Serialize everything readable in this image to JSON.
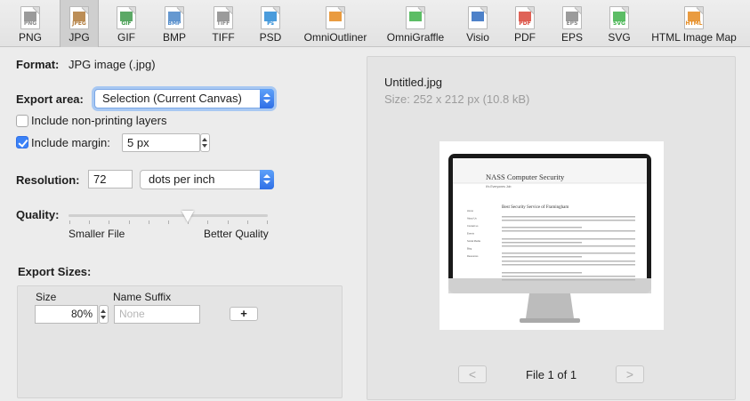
{
  "toolbar": {
    "formats": [
      {
        "label": "PNG",
        "icon": "png-file-icon",
        "ftext": "PNG",
        "color": "#8a8a8a",
        "selected": false
      },
      {
        "label": "JPG",
        "icon": "jpg-file-icon",
        "ftext": "JPEG",
        "color": "#b07a3a",
        "selected": true
      },
      {
        "label": "GIF",
        "icon": "gif-file-icon",
        "ftext": "GIF",
        "color": "#3f9a4b",
        "selected": false
      },
      {
        "label": "BMP",
        "icon": "bmp-file-icon",
        "ftext": "BMP",
        "color": "#4a86c8",
        "selected": false
      },
      {
        "label": "TIFF",
        "icon": "tiff-file-icon",
        "ftext": "TIFF",
        "color": "#8a8a8a",
        "selected": false
      },
      {
        "label": "PSD",
        "icon": "psd-file-icon",
        "ftext": "Ps",
        "color": "#2b8bd6",
        "selected": false
      },
      {
        "label": "OmniOutliner",
        "icon": "omnioutliner-file-icon",
        "ftext": "",
        "color": "#e58a1f",
        "selected": false
      },
      {
        "label": "OmniGraffle",
        "icon": "omnigraffle-file-icon",
        "ftext": "",
        "color": "#3fb24a",
        "selected": false
      },
      {
        "label": "Visio",
        "icon": "visio-file-icon",
        "ftext": "",
        "color": "#2e6bbf",
        "selected": false
      },
      {
        "label": "PDF",
        "icon": "pdf-file-icon",
        "ftext": "PDF",
        "color": "#d9473a",
        "selected": false
      },
      {
        "label": "EPS",
        "icon": "eps-file-icon",
        "ftext": "EPS",
        "color": "#8a8a8a",
        "selected": false
      },
      {
        "label": "SVG",
        "icon": "svg-file-icon",
        "ftext": "SVG",
        "color": "#3fb24a",
        "selected": false
      },
      {
        "label": "HTML Image Map",
        "icon": "html-file-icon",
        "ftext": "HTML",
        "color": "#e58a1f",
        "selected": false
      }
    ]
  },
  "format": {
    "label": "Format:",
    "value": "JPG image (.jpg)"
  },
  "export_area": {
    "label": "Export area:",
    "value": "Selection (Current Canvas)"
  },
  "include_nonprinting": {
    "label": "Include non-printing layers",
    "checked": false
  },
  "include_margin": {
    "label": "Include margin:",
    "checked": true,
    "value": "5 px"
  },
  "resolution": {
    "label": "Resolution:",
    "value": "72",
    "unit": "dots per inch"
  },
  "quality": {
    "label": "Quality:",
    "min_label": "Smaller File",
    "max_label": "Better Quality",
    "level": 0.6
  },
  "export_sizes": {
    "label": "Export Sizes:",
    "size_header": "Size",
    "suffix_header": "Name Suffix",
    "size_value": "80%",
    "suffix_placeholder": "None",
    "add_label": "+"
  },
  "preview": {
    "filename": "Untitled.jpg",
    "size_text": "Size:  252 x 212 px (10.8 kB)",
    "prev_label": "<",
    "next_label": ">",
    "counter": "File 1 of 1",
    "screen": {
      "title": "NASS Computer Security",
      "tagline": "It's Everyones Job",
      "heading": "Best Security Service of Framingham",
      "nav": [
        "Home",
        "About Us",
        "Contact us",
        "Events",
        "Social Media",
        "Blog",
        "Resources"
      ]
    }
  },
  "colors": {
    "accent": "#3b82f7",
    "focus_ring": "#a8c8f2"
  }
}
